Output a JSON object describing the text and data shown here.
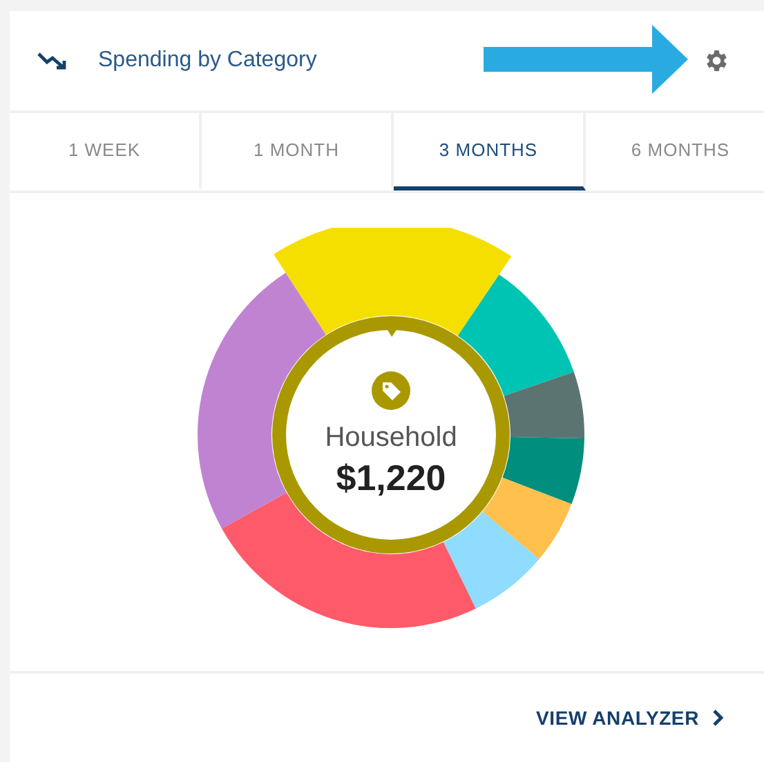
{
  "header": {
    "title": "Spending by Category"
  },
  "tabs": [
    {
      "label": "1 WEEK",
      "selected": false
    },
    {
      "label": "1 MONTH",
      "selected": false
    },
    {
      "label": "3 MONTHS",
      "selected": true
    },
    {
      "label": "6 MONTHS",
      "selected": false
    }
  ],
  "donut": {
    "segments": [
      {
        "color": "#f5df00",
        "selected": true
      },
      {
        "color": "#00c4b3",
        "selected": false
      },
      {
        "color": "#5b7472",
        "selected": false
      },
      {
        "color": "#008e7e",
        "selected": false
      },
      {
        "color": "#ffc04d",
        "selected": false
      },
      {
        "color": "#8fdcff",
        "selected": false
      },
      {
        "color": "#ff5a69",
        "selected": false
      },
      {
        "color": "#c083d2",
        "selected": false
      }
    ],
    "center": {
      "category": "Household",
      "amount": "$1,220"
    }
  },
  "footer": {
    "link": "VIEW ANALYZER"
  }
}
